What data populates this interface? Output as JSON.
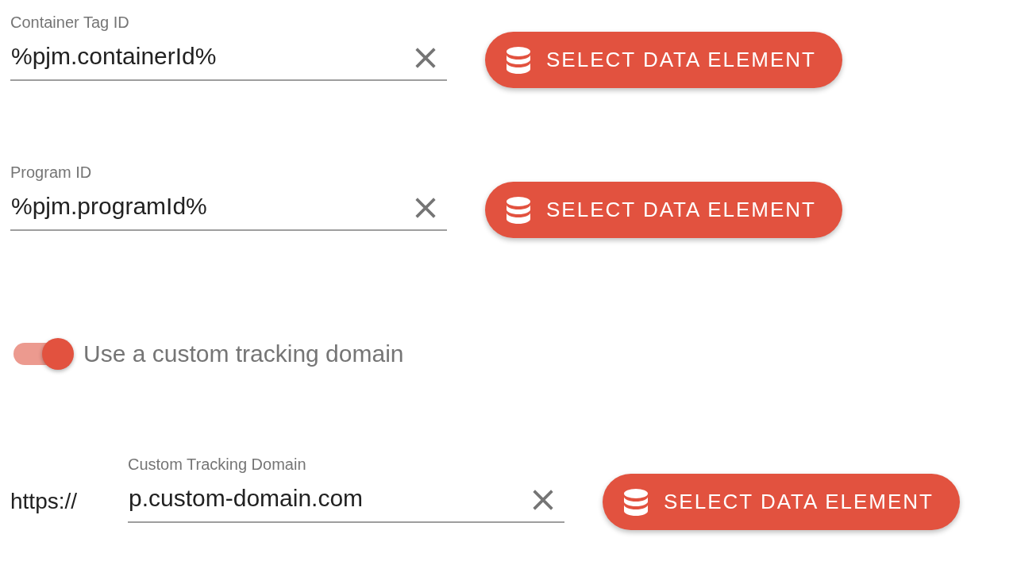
{
  "fields": [
    {
      "label": "Container Tag ID",
      "value": "%pjm.containerId%",
      "button": "SELECT DATA ELEMENT"
    },
    {
      "label": "Program ID",
      "value": "%pjm.programId%",
      "button": "SELECT DATA ELEMENT"
    }
  ],
  "toggle": {
    "label": "Use a custom tracking domain",
    "on": true
  },
  "domain": {
    "prefix": "https://",
    "label": "Custom Tracking Domain",
    "value": "p.custom-domain.com",
    "button": "SELECT DATA ELEMENT"
  }
}
